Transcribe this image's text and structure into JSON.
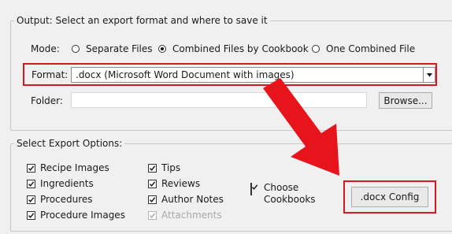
{
  "output_group": {
    "legend": "Output: Select an export format and where to save it",
    "mode_label": "Mode:",
    "modes": [
      {
        "label": "Separate Files",
        "selected": false
      },
      {
        "label": "Combined Files by Cookbook",
        "selected": true
      },
      {
        "label": "One Combined File",
        "selected": false
      }
    ],
    "format_label": "Format:",
    "format_value": ".docx (Microsoft Word Document with images)",
    "folder_label": "Folder:",
    "folder_value": "",
    "browse_label": "Browse..."
  },
  "export_options": {
    "legend": "Select Export Options:",
    "col1": [
      {
        "label": "Recipe Images",
        "checked": true
      },
      {
        "label": "Ingredients",
        "checked": true
      },
      {
        "label": "Procedures",
        "checked": true
      },
      {
        "label": "Procedure Images",
        "checked": true
      }
    ],
    "col2": [
      {
        "label": "Tips",
        "checked": true
      },
      {
        "label": "Reviews",
        "checked": true
      },
      {
        "label": "Author Notes",
        "checked": true
      },
      {
        "label": "Attachments",
        "checked": true,
        "disabled": true
      }
    ],
    "choose_cookbooks_line1": "Choose",
    "choose_cookbooks_line2": "Cookbooks",
    "choose_cookbooks_checked": true,
    "config_button_label": ".docx Config"
  },
  "annotation": {
    "highlight_color": "#d21a23",
    "arrow_color": "#e8141c"
  }
}
